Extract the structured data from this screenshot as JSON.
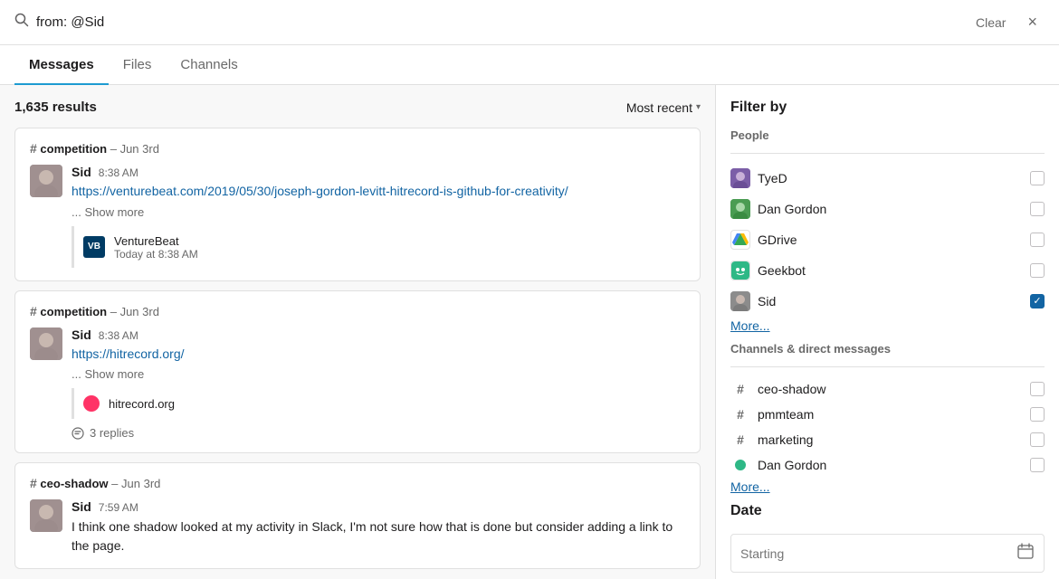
{
  "searchBar": {
    "query": "from: @Sid",
    "clearLabel": "Clear",
    "closeIcon": "×"
  },
  "tabs": [
    {
      "id": "messages",
      "label": "Messages",
      "active": true
    },
    {
      "id": "files",
      "label": "Files",
      "active": false
    },
    {
      "id": "channels",
      "label": "Channels",
      "active": false
    }
  ],
  "results": {
    "count": "1,635 results",
    "sortLabel": "Most recent",
    "cards": [
      {
        "channel": "competition",
        "date": "Jun 3rd",
        "sender": "Sid",
        "time": "8:38 AM",
        "link": "https://venturebeat.com/2019/05/30/joseph-gordon-levitt-hitrecord-is-github-for-creativity/",
        "linkText": "https://venturebeat.com/2019/05/30/joseph-gordon-levitt-hitrecord-is-github-for-creativity/",
        "showMore": "... Show more",
        "preview": {
          "logo": "VB",
          "logoType": "vb",
          "name": "VentureBeat",
          "time": "Today at 8:38 AM"
        }
      },
      {
        "channel": "competition",
        "date": "Jun 3rd",
        "sender": "Sid",
        "time": "8:38 AM",
        "link": "https://hitrecord.org/",
        "linkText": "https://hitrecord.org/",
        "showMore": "... Show more",
        "preview": {
          "logo": "●",
          "logoType": "hr",
          "name": "hitrecord.org",
          "time": ""
        },
        "replies": "3 replies"
      },
      {
        "channel": "ceo-shadow",
        "date": "Jun 3rd",
        "sender": "Sid",
        "time": "7:59 AM",
        "text": "I think one shadow looked at my activity in Slack, I'm not sure how that is done but consider adding a link to the page.",
        "link": null
      }
    ]
  },
  "filter": {
    "title": "Filter by",
    "peopleSectionLabel": "People",
    "people": [
      {
        "name": "TyeD",
        "avatarType": "tye",
        "checked": false
      },
      {
        "name": "Dan Gordon",
        "avatarType": "dan",
        "checked": false
      },
      {
        "name": "GDrive",
        "avatarType": "gdrive",
        "checked": false
      },
      {
        "name": "Geekbot",
        "avatarType": "geekbot",
        "checked": false
      },
      {
        "name": "Sid",
        "avatarType": "sid-av",
        "checked": true
      }
    ],
    "peopleModeLabel": "More...",
    "channelsSectionLabel": "Channels & direct messages",
    "channels": [
      {
        "name": "ceo-shadow",
        "type": "channel",
        "checked": false
      },
      {
        "name": "pmmteam",
        "type": "channel",
        "checked": false
      },
      {
        "name": "marketing",
        "type": "channel",
        "checked": false
      },
      {
        "name": "Dan Gordon",
        "type": "dm",
        "checked": false
      }
    ],
    "channelsMoreLabel": "More...",
    "dateSectionLabel": "Date",
    "dateInputPlaceholder": "Starting",
    "dateInputIcon": "🗓"
  }
}
